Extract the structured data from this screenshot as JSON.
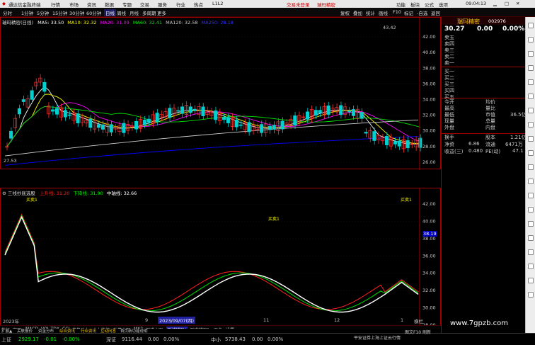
{
  "titlebar": {
    "app_name": "通达信金融终端",
    "menus": [
      "行情",
      "市场",
      "资讯",
      "数据",
      "专题",
      "交易",
      "服务",
      "行业",
      "热点",
      "L1L2"
    ],
    "login_text": "交易未登录",
    "stock_title": "瑞玛精密",
    "right_menus": [
      "功能",
      "板块",
      "公式",
      "选项"
    ],
    "time": "09:04:13"
  },
  "toolbar": {
    "periods": [
      "分时",
      "1分钟",
      "5分钟",
      "15分钟",
      "30分钟",
      "60分钟",
      "日线",
      "周线",
      "月线",
      "多周期",
      "更多"
    ],
    "active_period": "日线",
    "right_items": [
      "复权",
      "叠加",
      "统计",
      "画线",
      "F10",
      "标记",
      "-自选",
      "返回"
    ]
  },
  "main_chart": {
    "header_name": "瑞玛精密(日线)",
    "ma_labels": [
      {
        "text": "MA5: 33.50",
        "color": "#ffffff"
      },
      {
        "text": "MA10: 32.32",
        "color": "#ffff00"
      },
      {
        "text": "MA20: 31.09",
        "color": "#ff00ff"
      },
      {
        "text": "MA60: 32.41",
        "color": "#00e000"
      },
      {
        "text": "MA120: 32.58",
        "color": "#d0d0d0"
      },
      {
        "text": "MA250: 28.18",
        "color": "#0000ff"
      }
    ],
    "high_mark": "43.42",
    "low_mark": "27.53",
    "y_ticks": [
      "42.00",
      "40.00",
      "38.00",
      "36.00",
      "34.00",
      "32.00",
      "30.00",
      "28.00",
      "26.00"
    ]
  },
  "sub_chart": {
    "name": "三线抄底选股",
    "lines": [
      {
        "text": "上升线: 31.20",
        "color": "#ff2020"
      },
      {
        "text": "下降线: 31.90",
        "color": "#00e000"
      },
      {
        "text": "中轴线: 32.66",
        "color": "#ffffff"
      }
    ],
    "signals": [
      "买卖1",
      "买卖1",
      "买卖1"
    ],
    "y_ticks": [
      "42.00",
      "40.00",
      "38.00",
      "36.00",
      "34.00",
      "32.00",
      "30.00",
      "28.00"
    ],
    "current_value": "38.19"
  },
  "x_axis": {
    "labels": [
      "2023年",
      "9",
      "2023/09/07(四)",
      "11",
      "12",
      "1"
    ],
    "expand_label": "横栏"
  },
  "indicator_tabs": [
    "指标",
    "窗口",
    "MACD",
    "VOL-TDX",
    "CCI",
    "趋势动力",
    "主力监控",
    "私募主图",
    "MA2",
    "测式主图",
    "测试辅图A",
    "测式辅图B",
    "更多",
    "设置"
  ],
  "bottom_tabs": [
    "扩展▲",
    "关联报价",
    "资金分布",
    "综合资讯",
    "行业资讯",
    "互动问答",
    "首页新功能说明"
  ],
  "right_panel": {
    "stock_name": "瑞玛精密",
    "stock_code": "002976",
    "price": "30.27",
    "change1": "0.00",
    "change2": "0.00%",
    "order_rows": [
      "卖五",
      "卖四",
      "卖三",
      "卖二",
      "卖一",
      "买一",
      "买二",
      "买三",
      "买四",
      "买五"
    ],
    "stats_left": [
      "今开",
      "最高",
      "最低",
      "现量",
      "外盘"
    ],
    "stats_right": [
      "均价",
      "量比",
      "市值",
      "总量",
      "内盘"
    ],
    "market_value": "36.5亿",
    "extra": [
      {
        "label": "换手",
        "value": "",
        "label2": "股本",
        "value2": "1.21亿"
      },
      {
        "label": "净资",
        "value": "6.86",
        "label2": "流通",
        "value2": "6471万"
      },
      {
        "label": "收益(三)",
        "value": "0.480",
        "label2": "PE(动)",
        "value2": "47.1"
      }
    ]
  },
  "status_bar": {
    "sh_label": "上证",
    "sh_value": "2929.17",
    "sh_change": "-0.01",
    "sh_pct": "-0.00%",
    "sz_label": "深证",
    "sz_value": "9116.44",
    "sz_change": "0.00",
    "sz_pct": "0.00%",
    "zx_label": "中小",
    "zx_value": "5738.43",
    "zx_change": "0.00",
    "zx_pct": "0.00%",
    "broker": "平安证券上海上证云行情",
    "right_info": "图文F10 刷新",
    "watermark": "www.7gpzb.com"
  },
  "colors": {
    "up": "#ff3030",
    "down": "#00d0d0",
    "ma5": "#ffffff",
    "ma10": "#ffff00",
    "ma20": "#ff00ff",
    "ma60": "#00e000",
    "ma120": "#d0d0d0",
    "ma250": "#0000ff",
    "frame": "#a00000"
  }
}
